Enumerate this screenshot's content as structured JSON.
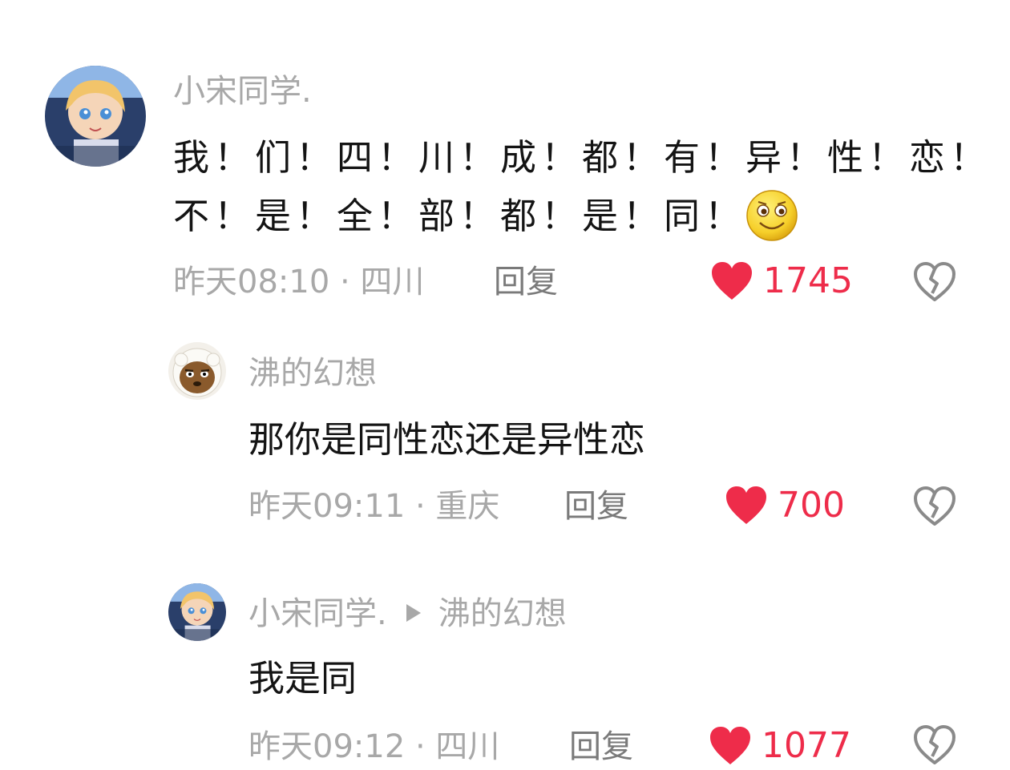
{
  "comments": [
    {
      "username": "小宋同学.",
      "line1": "我！们！四！川！成！都！有！异！性！恋！",
      "line2": "不！是！全！部！都！是！同！",
      "emoji": "smiling-face-emoji",
      "meta": "昨天08:10 · 四川",
      "reply_label": "回复",
      "likes": "1745"
    },
    {
      "username": "沸的幻想",
      "text": "那你是同性恋还是异性恋",
      "meta": "昨天09:11 · 重庆",
      "reply_label": "回复",
      "likes": "700"
    },
    {
      "username": "小宋同学.",
      "reply_to": "沸的幻想",
      "text": "我是同",
      "meta": "昨天09:12 · 四川",
      "reply_label": "回复",
      "likes": "1077"
    }
  ],
  "colors": {
    "like_red": "#ee2c4a",
    "muted_gray": "#a8a8a8",
    "text_dark": "#141414"
  },
  "icons": {
    "like": "heart-icon",
    "dislike": "broken-heart-icon"
  }
}
